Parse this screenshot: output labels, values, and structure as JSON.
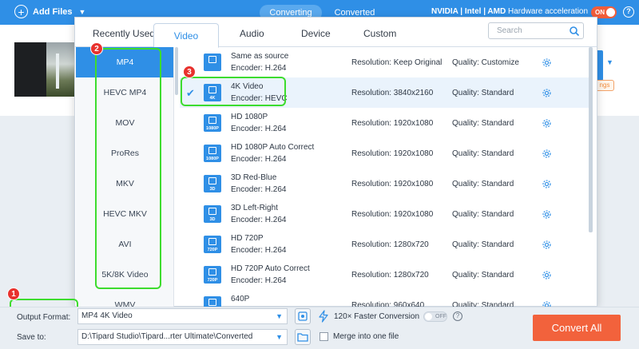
{
  "topbar": {
    "add_files": "Add Files",
    "tab_converting": "Converting",
    "tab_converted": "Converted",
    "hw_brands": "NVIDIA | Intel | AMD",
    "hw_label": "Hardware acceleration",
    "hw_toggle": "ON",
    "help": "?"
  },
  "main": {
    "settings_pill": "ngs"
  },
  "panel": {
    "tabs": [
      "Recently Used",
      "Video",
      "Audio",
      "Device",
      "Custom"
    ],
    "active_tab": "Video",
    "search_placeholder": "Search",
    "formats": [
      "MP4",
      "HEVC MP4",
      "MOV",
      "ProRes",
      "MKV",
      "HEVC MKV",
      "AVI",
      "5K/8K Video",
      "WMV"
    ],
    "active_format": "MP4",
    "profiles": [
      {
        "name": "Same as source",
        "encoder": "Encoder: H.264",
        "resolution": "Resolution: Keep Original",
        "quality": "Quality: Customize",
        "tag": "",
        "icon": "copy-icon"
      },
      {
        "name": "4K Video",
        "encoder": "Encoder: HEVC",
        "resolution": "Resolution: 3840x2160",
        "quality": "Quality: Standard",
        "tag": "4K",
        "icon": "film-icon",
        "selected": true
      },
      {
        "name": "HD 1080P",
        "encoder": "Encoder: H.264",
        "resolution": "Resolution: 1920x1080",
        "quality": "Quality: Standard",
        "tag": "1080P",
        "icon": "film-icon"
      },
      {
        "name": "HD 1080P Auto Correct",
        "encoder": "Encoder: H.264",
        "resolution": "Resolution: 1920x1080",
        "quality": "Quality: Standard",
        "tag": "1080P",
        "icon": "film-icon"
      },
      {
        "name": "3D Red-Blue",
        "encoder": "Encoder: H.264",
        "resolution": "Resolution: 1920x1080",
        "quality": "Quality: Standard",
        "tag": "3D",
        "icon": "cube-icon"
      },
      {
        "name": "3D Left-Right",
        "encoder": "Encoder: H.264",
        "resolution": "Resolution: 1920x1080",
        "quality": "Quality: Standard",
        "tag": "3D",
        "icon": "cube-icon"
      },
      {
        "name": "HD 720P",
        "encoder": "Encoder: H.264",
        "resolution": "Resolution: 1280x720",
        "quality": "Quality: Standard",
        "tag": "720P",
        "icon": "film-icon"
      },
      {
        "name": "HD 720P Auto Correct",
        "encoder": "Encoder: H.264",
        "resolution": "Resolution: 1280x720",
        "quality": "Quality: Standard",
        "tag": "720P",
        "icon": "film-icon"
      },
      {
        "name": "640P",
        "encoder": "Encoder: H.264",
        "resolution": "Resolution: 960x640",
        "quality": "Quality: Standard",
        "tag": "640P",
        "icon": "film-icon"
      }
    ]
  },
  "annotations": {
    "markers": [
      "1",
      "2",
      "3"
    ],
    "highlight_color": "#3ddc2e",
    "marker_color": "#e8322e"
  },
  "bottombar": {
    "output_format_label": "Output Format:",
    "output_format_value": "MP4 4K Video",
    "save_to_label": "Save to:",
    "save_to_value": "D:\\Tipard Studio\\Tipard...rter Ultimate\\Converted",
    "faster_label": "120× Faster Conversion",
    "faster_toggle": "OFF",
    "faster_help": "?",
    "merge_label": "Merge into one file",
    "convert_all": "Convert All"
  },
  "colors": {
    "accent": "#2f8fe6",
    "convert_button": "#f2623c",
    "hw_toggle_on": "#f25d3a"
  }
}
